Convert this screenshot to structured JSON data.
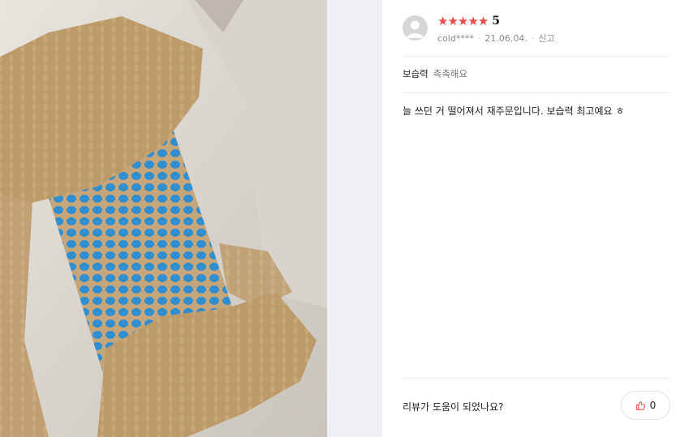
{
  "review": {
    "rating_value": "5",
    "star_count": 5,
    "reviewer_name": "cold****",
    "date": "21.06.04.",
    "report_label": "신고",
    "separator": "·",
    "attribute": {
      "label": "보습력",
      "value": "촉촉해요"
    },
    "body": "늘 쓰던 거 떨어져서 재주문입니다. 보습력 최고예요 ㅎ"
  },
  "feedback": {
    "question": "리뷰가 도움이 되었나요?",
    "like_count": "0"
  },
  "colors": {
    "star": "#ef4a4a",
    "like_icon": "#ef4a4a",
    "panel_strip": "#eff0f3"
  },
  "icons": [
    "avatar-placeholder-icon",
    "star-icon",
    "thumbs-up-icon"
  ]
}
